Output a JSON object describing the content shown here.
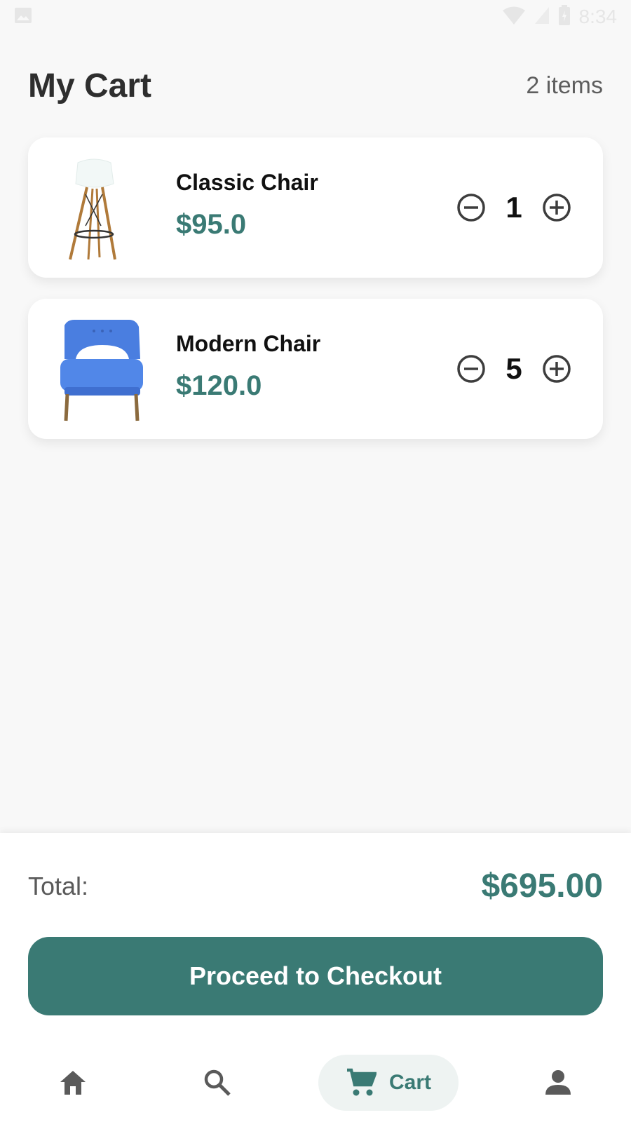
{
  "status_bar": {
    "time": "8:34"
  },
  "header": {
    "title": "My Cart",
    "item_count": "2 items"
  },
  "cart": {
    "items": [
      {
        "name": "Classic Chair",
        "price": "$95.0",
        "quantity": "1",
        "image": "white-shell-chair"
      },
      {
        "name": "Modern Chair",
        "price": "$120.0",
        "quantity": "5",
        "image": "blue-armchair"
      }
    ]
  },
  "summary": {
    "total_label": "Total:",
    "total_value": "$695.00",
    "checkout_label": "Proceed to Checkout"
  },
  "nav": {
    "items": [
      {
        "icon": "home-icon",
        "label": ""
      },
      {
        "icon": "search-icon",
        "label": ""
      },
      {
        "icon": "cart-icon",
        "label": "Cart",
        "active": true
      },
      {
        "icon": "person-icon",
        "label": ""
      }
    ]
  },
  "colors": {
    "accent": "#3a7a74",
    "background": "#f8f8f8",
    "card": "#ffffff",
    "active_nav_bg": "#eef3f2"
  }
}
